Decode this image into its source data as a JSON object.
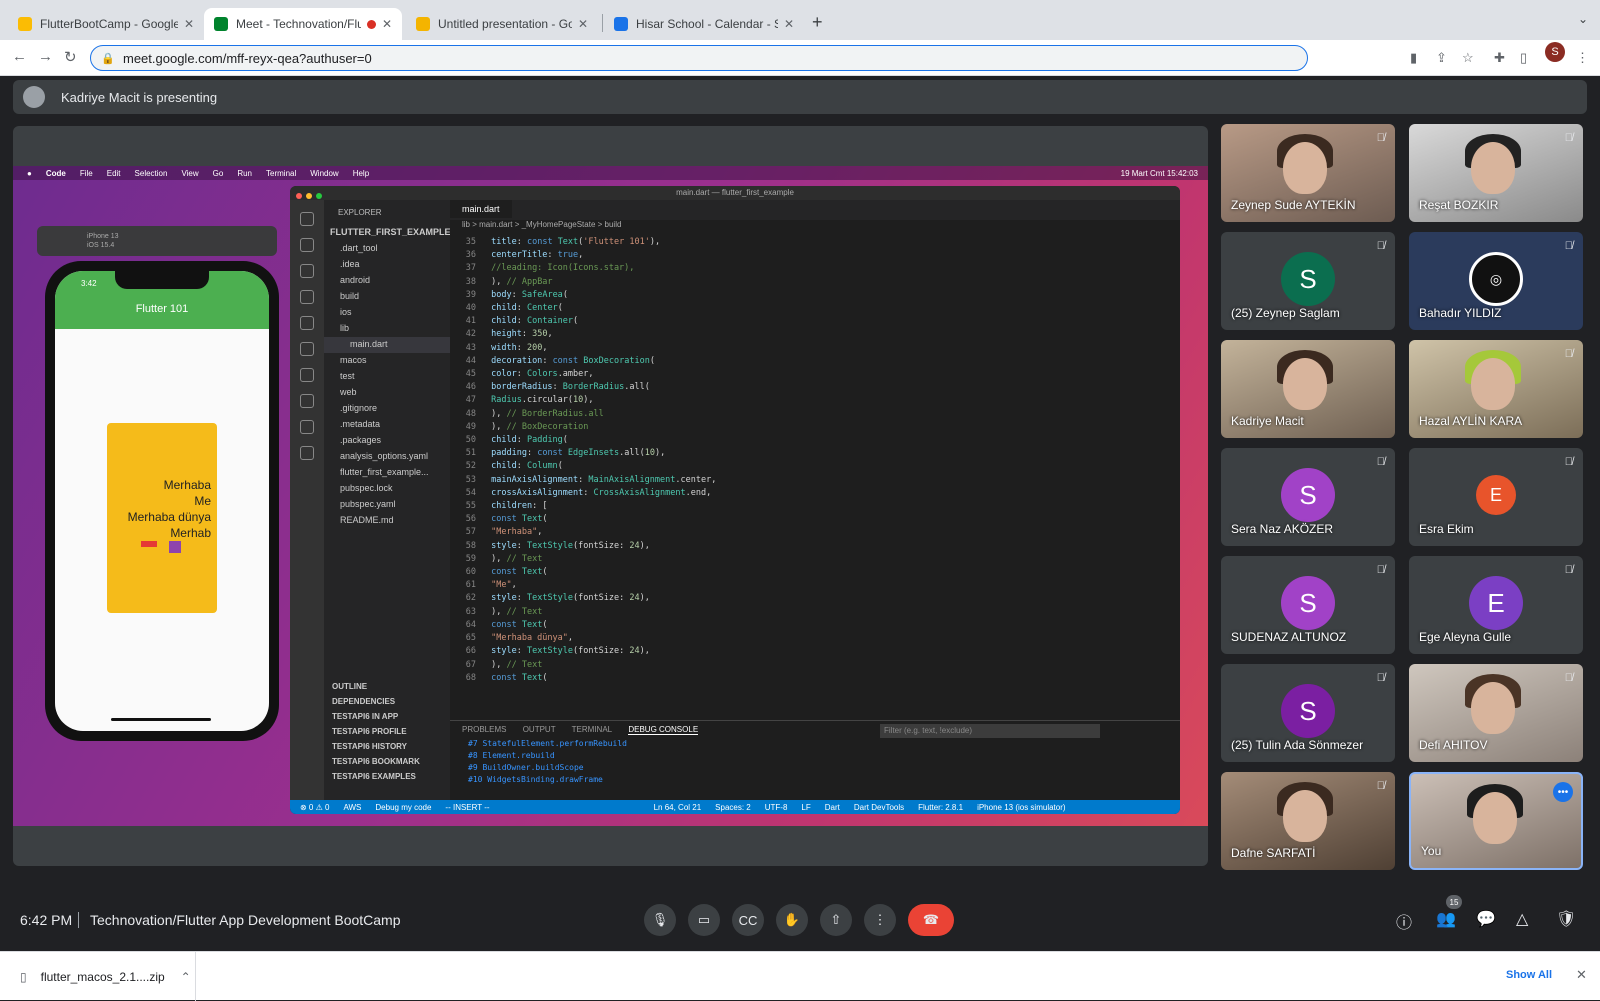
{
  "browser": {
    "tabs": [
      {
        "title": "FlutterBootCamp - Google Driv",
        "favicon_color": "#fbbc04"
      },
      {
        "title": "Meet - Technovation/Flutte",
        "favicon_color": "#00832d"
      },
      {
        "title": "Untitled presentation - Google",
        "favicon_color": "#f4b400"
      },
      {
        "title": "Hisar School - Calendar - Satu",
        "favicon_color": "#1a73e8"
      }
    ],
    "url": "meet.google.com/mff-reyx-qea?authuser=0",
    "profile_initial": "S"
  },
  "meet": {
    "presenting_text": "Kadriye Macit is presenting",
    "time": "6:42 PM",
    "meeting_name": "Technovation/Flutter App Development BootCamp",
    "people_count": "15",
    "participants": [
      {
        "name": "Zeynep Sude AYTEKİN",
        "type": "video"
      },
      {
        "name": "Reşat BOZKIR",
        "type": "video"
      },
      {
        "name": "(25) Zeynep Saglam",
        "type": "initial",
        "initial": "S",
        "color": "#0b6e4f"
      },
      {
        "name": "Bahadır YILDIZ",
        "type": "logo"
      },
      {
        "name": "Kadriye Macit",
        "type": "video"
      },
      {
        "name": "Hazal AYLİN KARA",
        "type": "video"
      },
      {
        "name": "Sera Naz AKÖZER",
        "type": "initial",
        "initial": "S",
        "color": "#a142c7"
      },
      {
        "name": "Esra Ekim",
        "type": "initial",
        "initial": "E",
        "color": "#e8542b"
      },
      {
        "name": "SUDENAZ ALTUNOZ",
        "type": "initial",
        "initial": "S",
        "color": "#a142c7"
      },
      {
        "name": "Ege Aleyna Gulle",
        "type": "initial",
        "initial": "E",
        "color": "#7b3fc4"
      },
      {
        "name": "(25) Tulin Ada Sönmezer",
        "type": "initial",
        "initial": "S",
        "color": "#7b1fa2"
      },
      {
        "name": "Defi AHITOV",
        "type": "video"
      },
      {
        "name": "Dafne SARFATİ",
        "type": "video"
      },
      {
        "name": "You",
        "type": "video"
      }
    ]
  },
  "screen": {
    "mac_menu": [
      "Code",
      "File",
      "Edit",
      "Selection",
      "View",
      "Go",
      "Run",
      "Terminal",
      "Window",
      "Help"
    ],
    "mac_clock": "19 Mart Cmt  15:42:03",
    "simulator_title": "iPhone 13",
    "simulator_sub": "iOS 15.4",
    "phone_time": "3:42",
    "app_title": "Flutter 101",
    "app_texts": [
      "Merhaba",
      "Me",
      "Merhaba dünya",
      "Merhab"
    ],
    "vscode_title": "main.dart — flutter_first_example",
    "explorer_header": "EXPLORER",
    "project": "FLUTTER_FIRST_EXAMPLE",
    "files": [
      ".dart_tool",
      ".idea",
      "android",
      "build",
      "ios",
      "lib",
      "main.dart",
      "macos",
      "test",
      "web",
      ".gitignore",
      ".metadata",
      ".packages",
      "analysis_options.yaml",
      "flutter_first_example...",
      "pubspec.lock",
      "pubspec.yaml",
      "README.md"
    ],
    "sections": [
      "OUTLINE",
      "DEPENDENCIES",
      "TESTAPI6 IN APP",
      "TESTAPI6 PROFILE",
      "TESTAPI6 HISTORY",
      "TESTAPI6 BOOKMARK",
      "TESTAPI6 EXAMPLES"
    ],
    "editor_tab": "main.dart",
    "breadcrumb": "lib > main.dart > _MyHomePageState > build",
    "panel_tabs": [
      "PROBLEMS",
      "OUTPUT",
      "TERMINAL",
      "DEBUG CONSOLE"
    ],
    "panel_filter": "Filter (e.g. text, !exclude)",
    "status_items": [
      "⊗ 0 ⚠ 0",
      "AWS",
      "Debug my code",
      "-- INSERT --",
      "Ln 64, Col 21",
      "Spaces: 2",
      "UTF-8",
      "LF",
      "Dart",
      "Dart DevTools",
      "Flutter: 2.8.1",
      "iPhone 13 (ios simulator)"
    ]
  },
  "download": {
    "file": "flutter_macos_2.1....zip",
    "show_all": "Show All"
  }
}
